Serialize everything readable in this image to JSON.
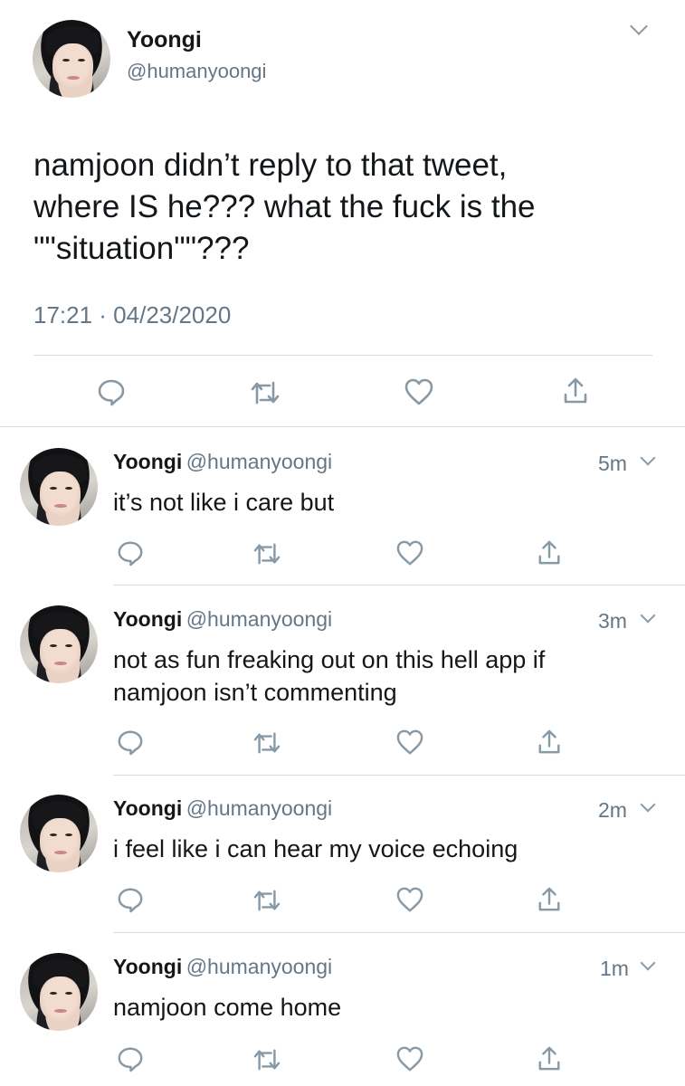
{
  "main_tweet": {
    "name": "Yoongi",
    "handle": "@humanyoongi",
    "text_lines": [
      "namjoon didn’t reply to that tweet,",
      "where IS he??? what the fuck is the",
      "\"\"situation\"\"???"
    ],
    "timestamp": "17:21 · 04/23/2020"
  },
  "replies": [
    {
      "name": "Yoongi",
      "handle": "@humanyoongi",
      "time": "5m",
      "text_lines": [
        "it’s not like i care but"
      ]
    },
    {
      "name": "Yoongi",
      "handle": "@humanyoongi",
      "time": "3m",
      "text_lines": [
        "not as fun freaking out on this hell app if",
        "namjoon isn’t commenting"
      ]
    },
    {
      "name": "Yoongi",
      "handle": "@humanyoongi",
      "time": "2m",
      "text_lines": [
        "i feel like i can hear my voice echoing"
      ]
    },
    {
      "name": "Yoongi",
      "handle": "@humanyoongi",
      "time": "1m",
      "text_lines": [
        "namjoon come home"
      ]
    }
  ],
  "icons": [
    "reply-icon",
    "retweet-icon",
    "like-icon",
    "share-icon",
    "chevron-down-icon"
  ],
  "colors": {
    "text": "#14171a",
    "secondary": "#657786",
    "divider": "#d6dde3"
  }
}
